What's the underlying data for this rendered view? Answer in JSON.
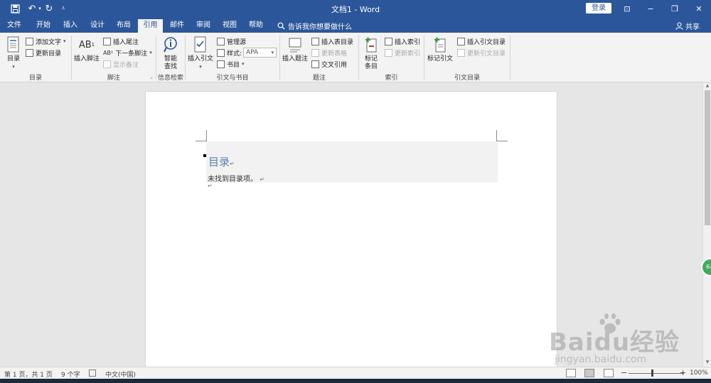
{
  "window": {
    "title": "文档1 - Word",
    "login_label": "登录",
    "minimize": "−",
    "restore": "❐",
    "close": "✕",
    "ribbon_display": "⊡"
  },
  "quick_access": {
    "save": "💾",
    "undo": "↶",
    "redo": "↻",
    "customize": "⩡"
  },
  "tabs": [
    {
      "label": "文件",
      "active": false
    },
    {
      "label": "开始",
      "active": false
    },
    {
      "label": "插入",
      "active": false
    },
    {
      "label": "设计",
      "active": false
    },
    {
      "label": "布局",
      "active": false
    },
    {
      "label": "引用",
      "active": true
    },
    {
      "label": "邮件",
      "active": false
    },
    {
      "label": "审阅",
      "active": false
    },
    {
      "label": "视图",
      "active": false
    },
    {
      "label": "帮助",
      "active": false
    }
  ],
  "tell_me": "告诉我你想要做什么",
  "share": "共享",
  "ribbon": {
    "toc": {
      "toc_button": "目录",
      "add_text": "添加文字",
      "update_toc": "更新目录",
      "group_label": "目录"
    },
    "footnotes": {
      "insert_footnote": "插入脚注",
      "insert_endnote": "插入尾注",
      "next_footnote": "下一条脚注",
      "show_notes": "显示备注",
      "group_label": "脚注"
    },
    "research": {
      "smart_lookup": "智能\n查找",
      "group_label": "信息检索"
    },
    "citations": {
      "insert_citation": "插入引文",
      "manage_sources": "管理源",
      "style_label": "样式:",
      "style_value": "APA",
      "bibliography": "书目",
      "group_label": "引文与书目"
    },
    "captions": {
      "insert_caption": "插入题注",
      "insert_table_of_figures": "插入表目录",
      "update_table": "更新表格",
      "cross_reference": "交叉引用",
      "group_label": "题注"
    },
    "index": {
      "mark_entry": "标记\n条目",
      "insert_index": "插入索引",
      "update_index": "更新索引",
      "group_label": "索引"
    },
    "authorities": {
      "mark_citation": "标记引文",
      "insert_toa": "插入引文目录",
      "update_toa": "更新引文目录",
      "group_label": "引文目录"
    }
  },
  "document": {
    "toc_heading": "目录",
    "toc_empty_message": "未找到目录项。",
    "para_mark": "↵"
  },
  "status": {
    "page": "第 1 页，共 1 页",
    "words": "9 个字",
    "language": "中文(中国)",
    "zoom_minus": "−",
    "zoom_plus": "+",
    "zoom": "100%",
    "zoom_level": 1.0
  },
  "float_badge": "64",
  "watermark": {
    "brand": "Baidu经验",
    "sub": "jingyan.baidu.com"
  },
  "colors": {
    "title_bar": "#2b579a",
    "ribbon": "#f3f3f3",
    "toc_heading": "#5b7fae"
  }
}
